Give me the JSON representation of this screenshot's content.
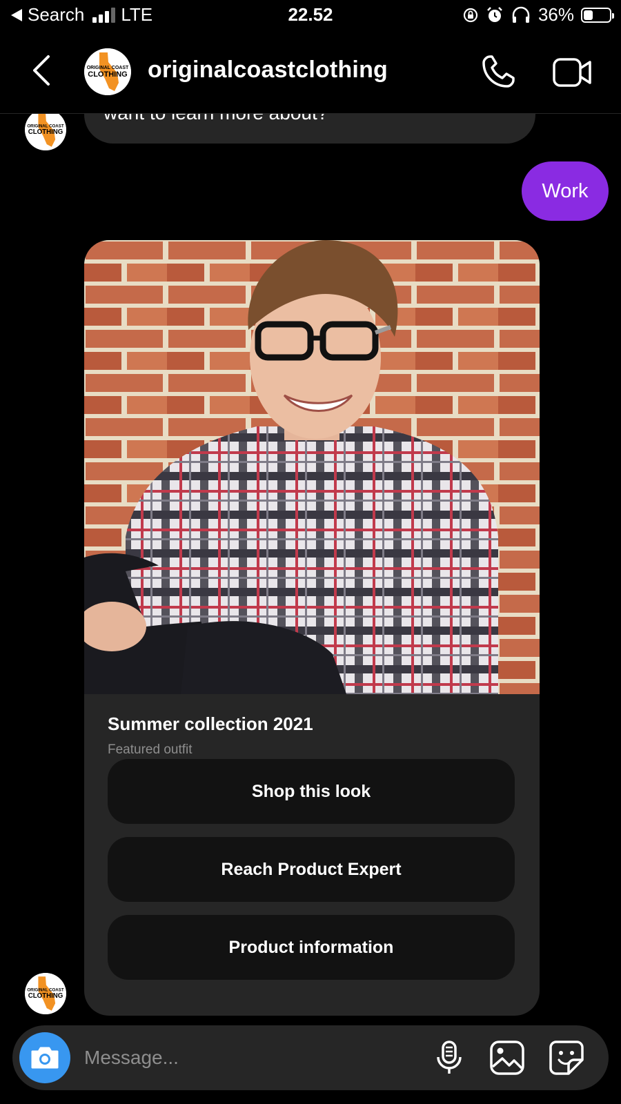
{
  "status_bar": {
    "back_label": "Search",
    "network": "LTE",
    "time": "22.52",
    "battery_percent": "36%",
    "battery_level": 0.36
  },
  "header": {
    "username": "originalcoastclothing",
    "avatar_logo_lines": [
      "ORIGINAL COAST",
      "CLOTHING"
    ]
  },
  "chat": {
    "partial_message": "want to learn more about?",
    "user_reply": "Work",
    "card": {
      "title": "Summer collection 2021",
      "subtitle": "Featured outfit",
      "buttons": [
        "Shop this look",
        "Reach Product Expert",
        "Product information"
      ]
    }
  },
  "composer": {
    "placeholder": "Message..."
  },
  "colors": {
    "accent_purple": "#8a2be2",
    "camera_blue": "#3897f0",
    "bubble_gray": "#262626"
  }
}
